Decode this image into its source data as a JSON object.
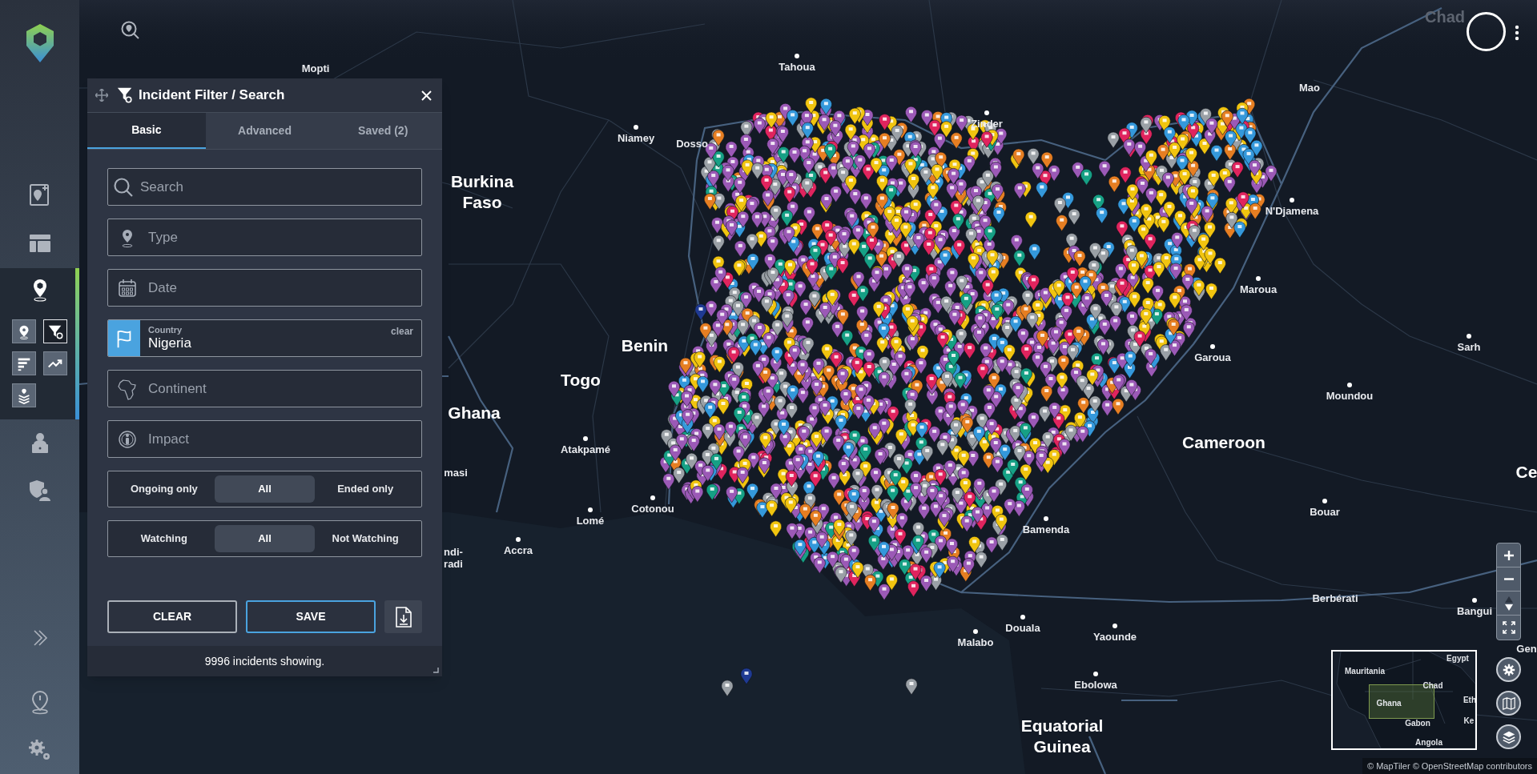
{
  "sidebar": {
    "items": [
      {
        "selected": false
      },
      {
        "selected": false
      },
      {
        "selected": true
      },
      {
        "selected": false
      },
      {
        "selected": false
      },
      {
        "selected": false
      },
      {
        "selected": false
      },
      {
        "selected": false
      }
    ],
    "tools": [
      {
        "selected": false
      },
      {
        "selected": true
      },
      {
        "selected": false
      },
      {
        "selected": false
      },
      {
        "selected": false
      }
    ]
  },
  "panel": {
    "title": "Incident Filter / Search",
    "tabs": [
      {
        "label": "Basic",
        "selected": true
      },
      {
        "label": "Advanced",
        "selected": false
      },
      {
        "label": "Saved (2)",
        "selected": false
      }
    ],
    "fields": [
      {
        "kind": "text",
        "placeholder": "Search"
      },
      {
        "kind": "text",
        "placeholder": "Type"
      },
      {
        "kind": "text",
        "placeholder": "Date"
      },
      {
        "kind": "select",
        "label": "Country",
        "value": "Nigeria",
        "action": "clear"
      },
      {
        "kind": "text",
        "placeholder": "Continent"
      },
      {
        "kind": "text",
        "placeholder": "Impact"
      }
    ],
    "toggles": [
      {
        "options": [
          {
            "label": "Ongoing only",
            "selected": false
          },
          {
            "label": "All",
            "selected": true
          },
          {
            "label": "Ended only",
            "selected": false
          }
        ]
      },
      {
        "options": [
          {
            "label": "Watching",
            "selected": false
          },
          {
            "label": "All",
            "selected": true
          },
          {
            "label": "Not Watching",
            "selected": false
          }
        ]
      }
    ],
    "buttons": [
      {
        "label": "CLEAR",
        "kind": "outline"
      },
      {
        "label": "SAVE",
        "kind": "primary"
      }
    ],
    "status": "9996 incidents showing."
  },
  "map": {
    "places": [
      {
        "name": "Mopti",
        "kind": "label"
      },
      {
        "name": "Tahoua",
        "kind": "city"
      },
      {
        "name": "Niamey",
        "kind": "city"
      },
      {
        "name": "Dosso",
        "kind": "label"
      },
      {
        "name": "Zinder",
        "kind": "city"
      },
      {
        "name": "Mao",
        "kind": "label"
      },
      {
        "name": "Burkina Faso",
        "kind": "country"
      },
      {
        "name": "N'Djamena",
        "kind": "city"
      },
      {
        "name": "Maroua",
        "kind": "city"
      },
      {
        "name": "Benin",
        "kind": "country"
      },
      {
        "name": "Garoua",
        "kind": "city"
      },
      {
        "name": "Sarh",
        "kind": "city"
      },
      {
        "name": "Togo",
        "kind": "country"
      },
      {
        "name": "Moundou",
        "kind": "city"
      },
      {
        "name": "Ghana",
        "kind": "country"
      },
      {
        "name": "Cameroon",
        "kind": "country"
      },
      {
        "name": "Atakpamé",
        "kind": "city"
      },
      {
        "name": "masi",
        "kind": "label"
      },
      {
        "name": "ndi-",
        "kind": "label"
      },
      {
        "name": "radi",
        "kind": "label"
      },
      {
        "name": "Cotonou",
        "kind": "city"
      },
      {
        "name": "Lomé",
        "kind": "city"
      },
      {
        "name": "Accra",
        "kind": "city"
      },
      {
        "name": "Bouar",
        "kind": "city"
      },
      {
        "name": "Bamenda",
        "kind": "city"
      },
      {
        "name": "Berbérati",
        "kind": "label"
      },
      {
        "name": "Bangui",
        "kind": "city"
      },
      {
        "name": "Malabo",
        "kind": "city"
      },
      {
        "name": "Douala",
        "kind": "city"
      },
      {
        "name": "Yaounde",
        "kind": "city"
      },
      {
        "name": "Ebolowa",
        "kind": "city"
      },
      {
        "name": "Equatorial Guinea",
        "kind": "country"
      },
      {
        "name": "Chad",
        "kind": "faded"
      },
      {
        "name": "Ce",
        "kind": "country"
      },
      {
        "name": "Gen",
        "kind": "label"
      }
    ],
    "minimap": [
      "Mauritania",
      "Egypt",
      "Chad",
      "Ghana",
      "Gabon",
      "Eth",
      "Ke",
      "Angola"
    ],
    "attribution": "© MapTiler © OpenStreetMap contributors"
  }
}
